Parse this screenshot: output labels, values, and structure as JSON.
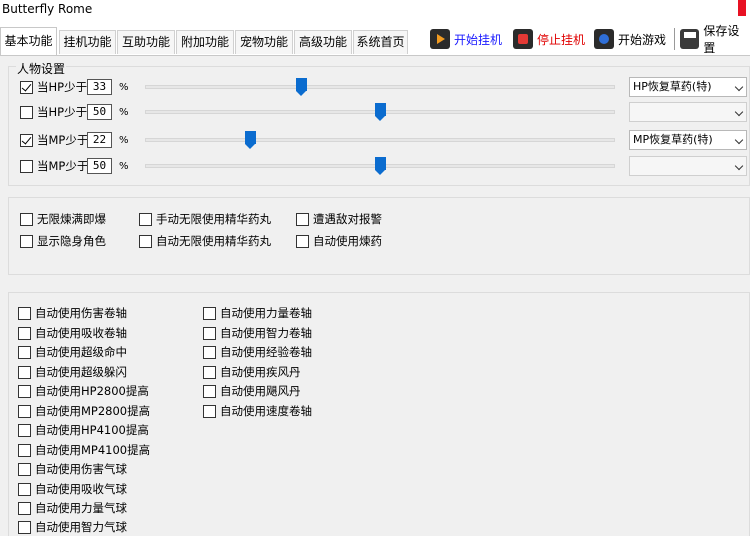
{
  "window": {
    "title": "Butterfly Rome"
  },
  "tabs": [
    {
      "label": "基本功能",
      "active": true
    },
    {
      "label": "挂机功能"
    },
    {
      "label": "互助功能"
    },
    {
      "label": "附加功能"
    },
    {
      "label": "宠物功能"
    },
    {
      "label": "高级功能"
    },
    {
      "label": "系统首页"
    }
  ],
  "toolbar": {
    "start_hang": "开始挂机",
    "stop_hang": "停止挂机",
    "start_game": "开始游戏",
    "save_settings": "保存设置",
    "colors": {
      "start_hang": "#1a1aff",
      "stop_hang": "#e00000"
    }
  },
  "character": {
    "legend": "人物设置",
    "rows": [
      {
        "label": "当HP少于",
        "value": "33",
        "unit": "%",
        "checked": true,
        "level": 33,
        "select": "HP恢复草药(特)"
      },
      {
        "label": "当HP少于",
        "value": "50",
        "unit": "%",
        "checked": false,
        "level": 50,
        "select": ""
      },
      {
        "label": "当MP少于",
        "value": "22",
        "unit": "%",
        "checked": true,
        "level": 22,
        "select": "MP恢复草药(特)"
      },
      {
        "label": "当MP少于",
        "value": "50",
        "unit": "%",
        "checked": false,
        "level": 50,
        "select": ""
      }
    ]
  },
  "options": [
    {
      "label": "无限煉满即爆"
    },
    {
      "label": "手动无限使用精华药丸"
    },
    {
      "label": "遭遇敌对报警"
    },
    {
      "label": "显示隐身角色"
    },
    {
      "label": "自动无限使用精华药丸"
    },
    {
      "label": "自动使用煉药"
    }
  ],
  "auto_left": [
    {
      "label": "自动使用伤害卷轴"
    },
    {
      "label": "自动使用吸收卷轴"
    },
    {
      "label": "自动使用超级命中"
    },
    {
      "label": "自动使用超级躲闪"
    },
    {
      "label": "自动使用HP2800提高"
    },
    {
      "label": "自动使用MP2800提高"
    },
    {
      "label": "自动使用HP4100提高"
    },
    {
      "label": "自动使用MP4100提高"
    },
    {
      "label": "自动使用伤害气球"
    },
    {
      "label": "自动使用吸收气球"
    },
    {
      "label": "自动使用力量气球"
    },
    {
      "label": "自动使用智力气球"
    }
  ],
  "auto_right": [
    {
      "label": "自动使用力量卷轴"
    },
    {
      "label": "自动使用智力卷轴"
    },
    {
      "label": "自动使用经验卷轴"
    },
    {
      "label": "自动使用疾风丹"
    },
    {
      "label": "自动使用飓风丹"
    },
    {
      "label": "自动使用速度卷轴"
    }
  ]
}
